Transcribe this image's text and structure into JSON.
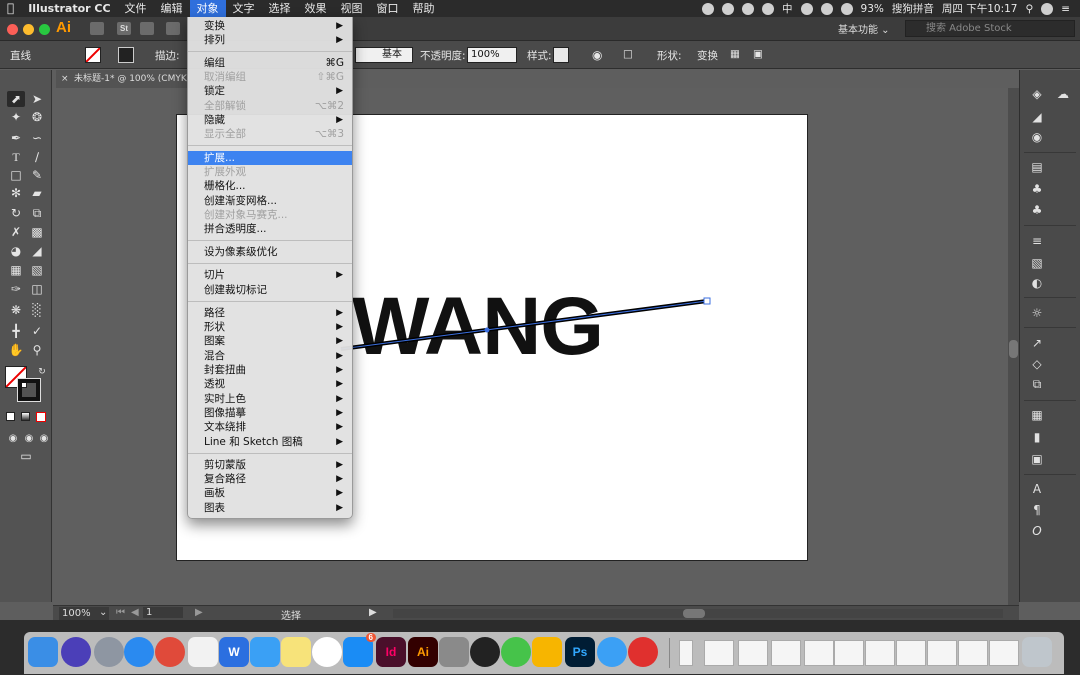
{
  "menubar": {
    "app_name": "Illustrator CC",
    "items": [
      "文件",
      "编辑",
      "对象",
      "文字",
      "选择",
      "效果",
      "视图",
      "窗口",
      "帮助"
    ],
    "active": "对象",
    "battery": "93%",
    "input_method": "搜狗拼音",
    "clock": "周四 下午10:17",
    "input_char": "中"
  },
  "appbar": {
    "logo": "Ai",
    "st": "St",
    "workspace": "基本功能",
    "stock_search_placeholder": "搜索 Adobe Stock"
  },
  "control_bar": {
    "selection_type": "直线",
    "stroke_label": "描边:",
    "stroke_profile": "基本",
    "opacity_label": "不透明度:",
    "opacity_value": "100%",
    "style_label": "样式:",
    "shape_label": "形状:",
    "transform_label": "变换"
  },
  "document_tab": {
    "title": "未标题-1* @ 100% (CMYK/GPU"
  },
  "canvas": {
    "text": "WANG"
  },
  "status_bar": {
    "zoom": "100%",
    "page": "1",
    "tool": "选择"
  },
  "object_menu": {
    "items": [
      {
        "label": "变换",
        "shortcut": "",
        "submenu": true,
        "disabled": false
      },
      {
        "label": "排列",
        "shortcut": "",
        "submenu": true,
        "disabled": false
      },
      {
        "label": "编组",
        "shortcut": "⌘G",
        "submenu": false,
        "disabled": false
      },
      {
        "label": "取消编组",
        "shortcut": "⇧⌘G",
        "submenu": false,
        "disabled": true
      },
      {
        "label": "锁定",
        "shortcut": "",
        "submenu": true,
        "disabled": false
      },
      {
        "label": "全部解锁",
        "shortcut": "⌥⌘2",
        "submenu": false,
        "disabled": true
      },
      {
        "label": "隐藏",
        "shortcut": "",
        "submenu": true,
        "disabled": false
      },
      {
        "label": "显示全部",
        "shortcut": "⌥⌘3",
        "submenu": false,
        "disabled": true
      },
      {
        "label": "扩展...",
        "shortcut": "",
        "submenu": false,
        "disabled": false,
        "highlighted": true
      },
      {
        "label": "扩展外观",
        "shortcut": "",
        "submenu": false,
        "disabled": true
      },
      {
        "label": "栅格化...",
        "shortcut": "",
        "submenu": false,
        "disabled": false
      },
      {
        "label": "创建渐变网格...",
        "shortcut": "",
        "submenu": false,
        "disabled": false
      },
      {
        "label": "创建对象马赛克...",
        "shortcut": "",
        "submenu": false,
        "disabled": true
      },
      {
        "label": "拼合透明度...",
        "shortcut": "",
        "submenu": false,
        "disabled": false
      },
      {
        "label": "设为像素级优化",
        "shortcut": "",
        "submenu": false,
        "disabled": false
      },
      {
        "label": "切片",
        "shortcut": "",
        "submenu": true,
        "disabled": false
      },
      {
        "label": "创建裁切标记",
        "shortcut": "",
        "submenu": false,
        "disabled": false
      },
      {
        "label": "路径",
        "shortcut": "",
        "submenu": true,
        "disabled": false
      },
      {
        "label": "形状",
        "shortcut": "",
        "submenu": true,
        "disabled": false
      },
      {
        "label": "图案",
        "shortcut": "",
        "submenu": true,
        "disabled": false
      },
      {
        "label": "混合",
        "shortcut": "",
        "submenu": true,
        "disabled": false
      },
      {
        "label": "封套扭曲",
        "shortcut": "",
        "submenu": true,
        "disabled": false
      },
      {
        "label": "透视",
        "shortcut": "",
        "submenu": true,
        "disabled": false
      },
      {
        "label": "实时上色",
        "shortcut": "",
        "submenu": true,
        "disabled": false
      },
      {
        "label": "图像描摹",
        "shortcut": "",
        "submenu": true,
        "disabled": false
      },
      {
        "label": "文本绕排",
        "shortcut": "",
        "submenu": true,
        "disabled": false
      },
      {
        "label": "Line 和 Sketch 图稿",
        "shortcut": "",
        "submenu": true,
        "disabled": false
      },
      {
        "label": "剪切蒙版",
        "shortcut": "",
        "submenu": true,
        "disabled": false
      },
      {
        "label": "复合路径",
        "shortcut": "",
        "submenu": true,
        "disabled": false
      },
      {
        "label": "画板",
        "shortcut": "",
        "submenu": true,
        "disabled": false
      },
      {
        "label": "图表",
        "shortcut": "",
        "submenu": true,
        "disabled": false
      }
    ]
  },
  "dock": {
    "apps": [
      "Finder",
      "Siri",
      "Launchpad",
      "Safari",
      "Chrome",
      "Preview",
      "WPS",
      "Mail",
      "Notes",
      "Photos",
      "App Store",
      "Id",
      "Ai",
      "Calculator",
      "QQ",
      "WeChat",
      "Sketch",
      "Ps",
      "Messages",
      "NetEase Music"
    ],
    "badge_app_store": "6"
  }
}
